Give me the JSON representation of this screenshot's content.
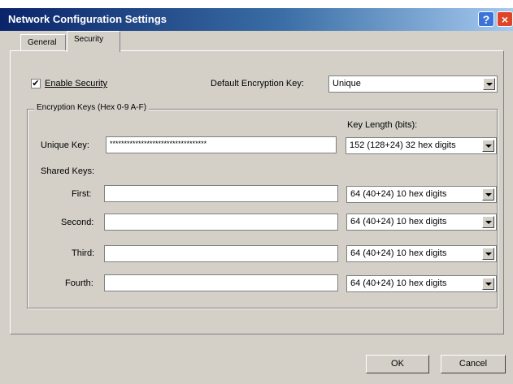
{
  "window": {
    "title": "Network Configuration Settings",
    "help_label": "?",
    "close_label": "×"
  },
  "tabs": [
    {
      "label": "General"
    },
    {
      "label": "Security"
    }
  ],
  "security": {
    "enable_label": "Enable Security",
    "enable_checked": true,
    "check_mark": "✔",
    "default_key_label": "Default Encryption Key:",
    "default_key_value": "Unique",
    "group_title": "Encryption Keys (Hex 0-9 A-F)",
    "key_length_label": "Key Length (bits):",
    "unique_key_label": "Unique Key:",
    "unique_key_value": "**********************************",
    "unique_key_length": "152 (128+24) 32 hex digits",
    "shared_keys_label": "Shared Keys:",
    "shared_keys": [
      {
        "label": "First:",
        "value": "",
        "length": "64 (40+24) 10 hex digits"
      },
      {
        "label": "Second:",
        "value": "",
        "length": "64 (40+24) 10 hex digits"
      },
      {
        "label": "Third:",
        "value": "",
        "length": "64 (40+24) 10 hex digits"
      },
      {
        "label": "Fourth:",
        "value": "",
        "length": "64 (40+24) 10 hex digits"
      }
    ]
  },
  "buttons": {
    "ok": "OK",
    "cancel": "Cancel"
  },
  "colors": {
    "title_start": "#0a246a",
    "title_end": "#a6caf0",
    "dialog_bg": "#d4d0c8",
    "close": "#e04428"
  }
}
